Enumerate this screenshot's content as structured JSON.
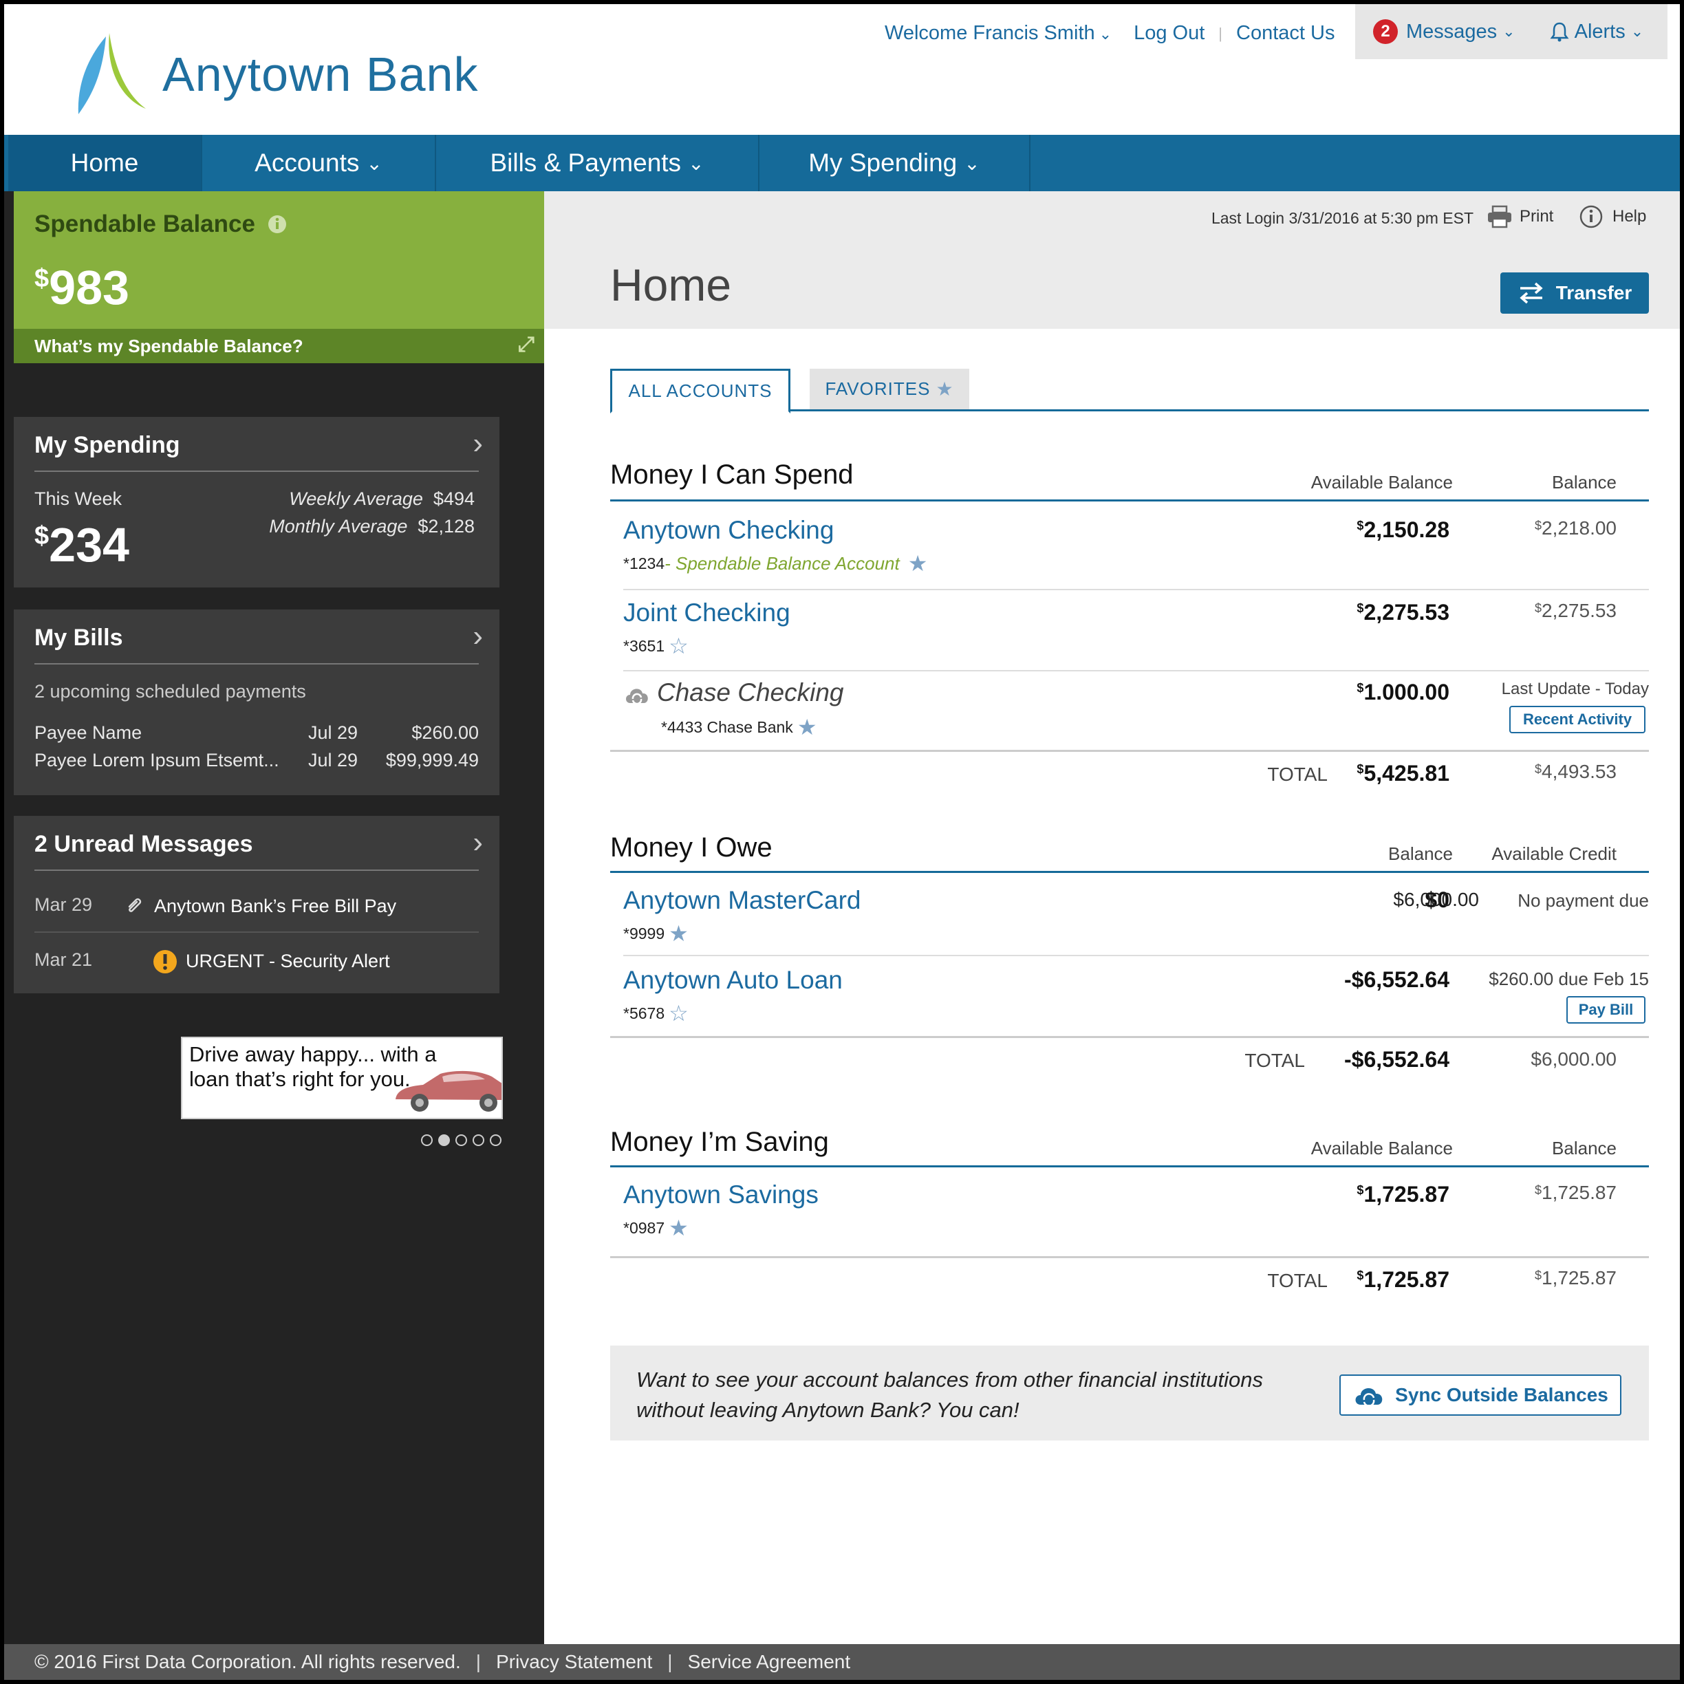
{
  "header": {
    "logo_text": "Anytown Bank",
    "welcome": "Welcome Francis Smith",
    "logout": "Log Out",
    "contact": "Contact Us",
    "messages_count": "2",
    "messages_label": "Messages",
    "alerts_label": "Alerts"
  },
  "nav": {
    "home": "Home",
    "accounts": "Accounts",
    "bills": "Bills & Payments",
    "spending": "My Spending"
  },
  "sidebar": {
    "spendable_label": "Spendable Balance",
    "spendable_amount": "983",
    "spendable_currency": "$",
    "spendable_help": "What’s my Spendable Balance?",
    "my_spending": {
      "title": "My Spending",
      "this_week_label": "This Week",
      "this_week_amount": "234",
      "weekly_avg_label": "Weekly Average",
      "weekly_avg_value": "$494",
      "monthly_avg_label": "Monthly Average",
      "monthly_avg_value": "$2,128"
    },
    "my_bills": {
      "title": "My Bills",
      "summary": "2 upcoming scheduled payments",
      "payments": [
        {
          "payee": "Payee Name",
          "date": "Jul 29",
          "amount": "$260.00"
        },
        {
          "payee": "Payee Lorem Ipsum Etsemt...",
          "date": "Jul 29",
          "amount": "$99,999.49"
        }
      ]
    },
    "messages": {
      "title": "2 Unread Messages",
      "items": [
        {
          "date": "Mar 29",
          "text": "Anytown Bank’s Free Bill Pay"
        },
        {
          "date": "Mar 21",
          "text": "URGENT - Security Alert"
        }
      ]
    },
    "ad_text": "Drive away happy... with a loan that’s right for you."
  },
  "main": {
    "last_login": "Last Login 3/31/2016 at 5:30 pm EST",
    "print": "Print",
    "help": "Help",
    "title": "Home",
    "transfer": "Transfer",
    "tabs": {
      "all": "ALL ACCOUNTS",
      "favorites": "FAVORITES"
    },
    "spend": {
      "title": "Money I Can Spend",
      "col1": "Available Balance",
      "col2": "Balance",
      "accounts": [
        {
          "name": "Anytown Checking",
          "num": "*1234",
          "tag": " - Spendable Balance Account",
          "avail": "2,150.28",
          "bal": "2,218.00"
        },
        {
          "name": "Joint Checking",
          "num": "*3651",
          "avail": "2,275.53",
          "bal": "2,275.53"
        },
        {
          "name": "Chase Checking",
          "num": "*4433 Chase Bank",
          "avail": "1.000.00",
          "note": "Last Update - Today",
          "button": "Recent Activity"
        }
      ],
      "total_label": "TOTAL",
      "total_avail": "5,425.81",
      "total_bal": "4,493.53"
    },
    "owe": {
      "title": "Money I Owe",
      "col1": "Balance",
      "col2": "Available Credit",
      "accounts": [
        {
          "name": "Anytown MasterCard",
          "num": "*9999",
          "bal": "$0",
          "credit": "$6,000.00",
          "note": "No payment due"
        },
        {
          "name": "Anytown Auto Loan",
          "num": "*5678",
          "bal": "-$6,552.64",
          "note": "$260.00 due Feb 15",
          "button": "Pay Bill"
        }
      ],
      "total_label": "TOTAL",
      "total_bal": "-$6,552.64",
      "total_credit": "$6,000.00"
    },
    "save": {
      "title": "Money I’m Saving",
      "col1": "Available Balance",
      "col2": "Balance",
      "accounts": [
        {
          "name": "Anytown Savings",
          "num": "*0987",
          "avail": "1,725.87",
          "bal": "1,725.87"
        }
      ],
      "total_label": "TOTAL",
      "total_avail": "1,725.87",
      "total_bal": "1,725.87"
    },
    "sync_text": "Want to see your account balances from other financial institutions without leaving Anytown Bank? You can!",
    "sync_button": "Sync Outside Balances"
  },
  "footer": {
    "copyright": "© 2016 First Data Corporation. All rights reserved.",
    "privacy": "Privacy Statement",
    "service": "Service Agreement"
  },
  "colors": {
    "brand_blue": "#156a99",
    "spend_green": "#87b03e",
    "sidebar_dark": "#232323"
  }
}
